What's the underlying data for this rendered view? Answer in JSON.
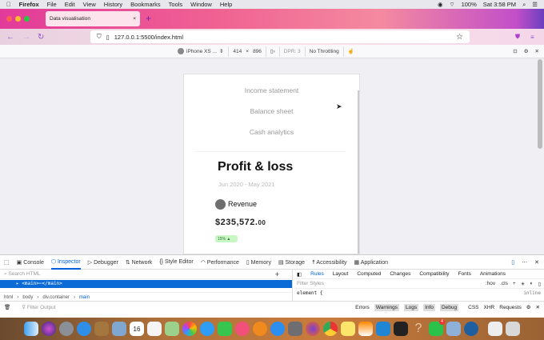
{
  "menubar": {
    "app": "Firefox",
    "items": [
      "File",
      "Edit",
      "View",
      "History",
      "Bookmarks",
      "Tools",
      "Window",
      "Help"
    ],
    "battery": "100%",
    "clock": "Sat 3:58 PM"
  },
  "tab": {
    "title": "Data visualisation",
    "new_tab": "+",
    "close": "×"
  },
  "url": "127.0.0.1:5500/index.html",
  "rdm": {
    "device": "iPhone XS ...",
    "width": "414",
    "x": "×",
    "height": "896",
    "dpr": "DPR: 3",
    "throttling": "No Throttling"
  },
  "page": {
    "nav": [
      "Income statement",
      "Balance sheet",
      "Cash analytics"
    ],
    "title": "Profit & loss",
    "period": "Jun 2020 - May 2021",
    "metric_label": "Revenue",
    "amount_main": "$235,572.",
    "amount_cents": "00",
    "badge": "15% ▲"
  },
  "devtools": {
    "tabs": [
      "Console",
      "Inspector",
      "Debugger",
      "Network",
      "Style Editor",
      "Performance",
      "Memory",
      "Storage",
      "Accessibility",
      "Application"
    ],
    "search_placeholder": "Search HTML",
    "selected_node": "<main>⋯</main>",
    "breadcrumb": [
      "html",
      "body",
      "div.container",
      "main"
    ],
    "side_tabs": [
      "Rules",
      "Layout",
      "Computed",
      "Changes",
      "Compatibility",
      "Fonts",
      "Animations"
    ],
    "filter_styles": "Filter Styles",
    "hov": ":hov",
    "cls": ".cls",
    "element_rule": "element {",
    "inline": "inline",
    "filter_output": "Filter Output",
    "console_filters": [
      "Errors",
      "Warnings",
      "Logs",
      "Info",
      "Debug"
    ],
    "console_extra": [
      "CSS",
      "XHR",
      "Requests"
    ]
  },
  "dock": {
    "whatsapp_badge": "4",
    "calendar_day": "16",
    "apps": [
      "finder",
      "siri",
      "launchpad",
      "safari",
      "notes-brown",
      "preview",
      "calendar",
      "reminders",
      "maps",
      "photos",
      "messages",
      "facetime",
      "music",
      "books",
      "app-store",
      "system-preferences",
      "firefox",
      "chrome",
      "notes",
      "vlc",
      "vscode",
      "terminal",
      "help",
      "whatsapp",
      "image-capture",
      "quicktime",
      "keychain",
      "trash"
    ]
  },
  "colors": {
    "accent": "#0060df",
    "badge_bg": "#c8f7c5"
  }
}
